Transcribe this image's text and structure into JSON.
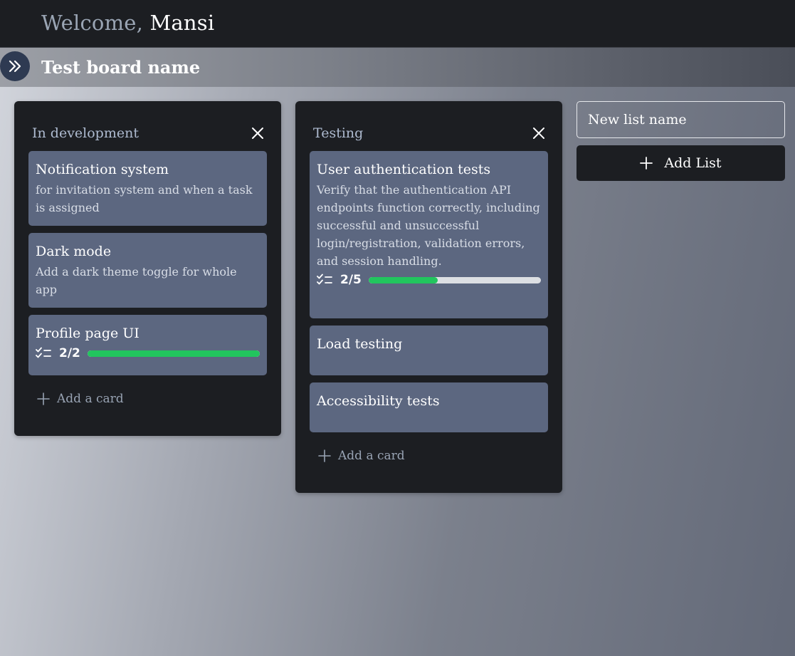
{
  "header": {
    "welcome_prefix": "Welcome,",
    "user_name": "Mansi"
  },
  "board": {
    "title": "Test board name",
    "expand_icon": "chevron-double-right-icon"
  },
  "lists": [
    {
      "title": "In development",
      "add_card_label": "Add a card",
      "cards": [
        {
          "title": "Notification system",
          "description": "for invitation system and when a task is assigned"
        },
        {
          "title": "Dark mode",
          "description": "Add a dark theme toggle for whole app"
        },
        {
          "title": "Profile page UI",
          "checklist": {
            "text": "2/2",
            "done": 2,
            "total": 2
          }
        }
      ]
    },
    {
      "title": "Testing",
      "add_card_label": "Add a card",
      "cards": [
        {
          "title": "User authentication tests",
          "description": "Verify that the authentication API endpoints function correctly, including successful and unsuccessful login/registration, validation errors, and session handling.",
          "checklist": {
            "text": "2/5",
            "done": 2,
            "total": 5
          }
        },
        {
          "title": "Load testing"
        },
        {
          "title": "Accessibility tests"
        }
      ]
    }
  ],
  "new_list": {
    "placeholder": "New list name",
    "add_button_label": "Add List"
  },
  "colors": {
    "progress_fill": "#22c55e",
    "card_bg": "#5c6780",
    "list_bg": "#1c1e22"
  }
}
